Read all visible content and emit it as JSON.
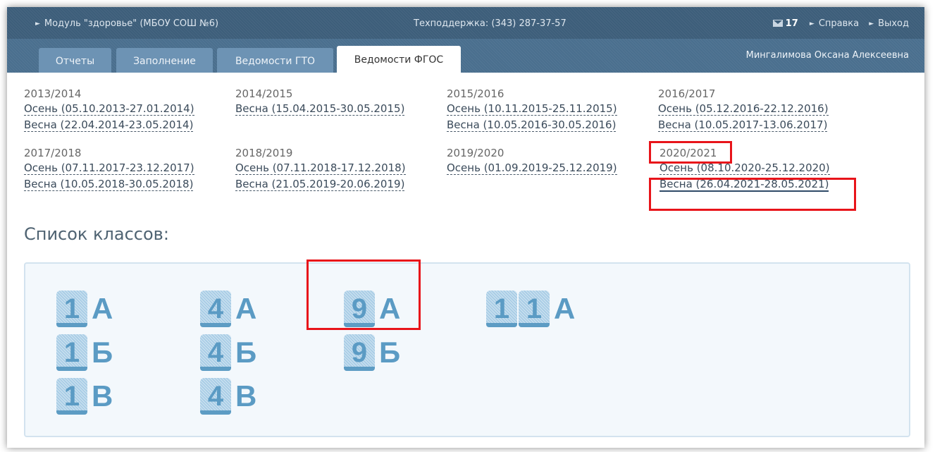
{
  "topbar": {
    "module": "Модуль \"здоровье\" (МБОУ СОШ №6)",
    "support": "Техподдержка: (343) 287-37-57",
    "mail_count": "17",
    "help": "Справка",
    "logout": "Выход"
  },
  "tabs": [
    "Отчеты",
    "Заполнение",
    "Ведомости ГТО",
    "Ведомости ФГОС"
  ],
  "user": "Мингалимова Оксана Алексеевна",
  "years": [
    {
      "year": "2013/2014",
      "periods": [
        "Осень (05.10.2013-27.01.2014)",
        "Весна (22.04.2014-23.05.2014)"
      ]
    },
    {
      "year": "2014/2015",
      "periods": [
        "Весна (15.04.2015-30.05.2015)"
      ]
    },
    {
      "year": "2015/2016",
      "periods": [
        "Осень (10.11.2015-25.11.2015)",
        "Весна (10.05.2016-30.05.2016)"
      ]
    },
    {
      "year": "2016/2017",
      "periods": [
        "Осень (05.12.2016-22.12.2016)",
        "Весна (10.05.2017-13.06.2017)"
      ]
    },
    {
      "year": "2017/2018",
      "periods": [
        "Осень (07.11.2017-23.12.2017)",
        "Весна (10.05.2018-30.05.2018)"
      ]
    },
    {
      "year": "2018/2019",
      "periods": [
        "Осень (07.11.2018-17.12.2018)",
        "Весна (21.05.2019-20.06.2019)"
      ]
    },
    {
      "year": "2019/2020",
      "periods": [
        "Осень (01.09.2019-25.12.2019)"
      ]
    },
    {
      "year": "2020/2021",
      "periods": [
        "Осень (08.10.2020-25.12.2020)",
        "Весна (26.04.2021-28.05.2021)"
      ]
    }
  ],
  "classes_title": "Список классов:",
  "classes": [
    {
      "num": [
        "1"
      ],
      "letter": "А"
    },
    {
      "num": [
        "1"
      ],
      "letter": "Б"
    },
    {
      "num": [
        "1"
      ],
      "letter": "В"
    },
    {
      "num": [
        "4"
      ],
      "letter": "А"
    },
    {
      "num": [
        "4"
      ],
      "letter": "Б"
    },
    {
      "num": [
        "4"
      ],
      "letter": "В"
    },
    {
      "num": [
        "9"
      ],
      "letter": "А"
    },
    {
      "num": [
        "9"
      ],
      "letter": "Б"
    },
    {
      "num": [
        "1",
        "1"
      ],
      "letter": "А"
    }
  ],
  "colors": {
    "highlight": "#e8141a",
    "accent": "#5b9bc4",
    "header": "#3d5e7a"
  }
}
